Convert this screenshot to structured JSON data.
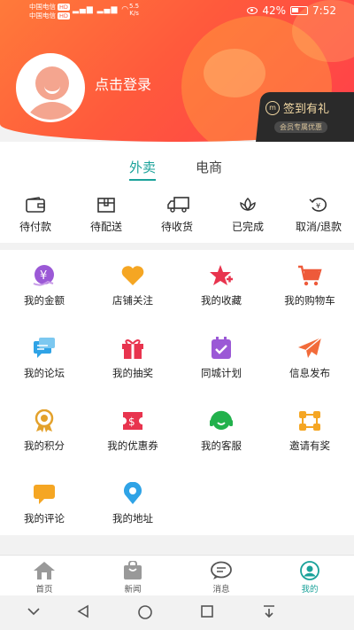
{
  "status_bar": {
    "carrier1": "中国电信",
    "carrier2": "中国电信",
    "hd": "HD",
    "speed_value": "5.5",
    "speed_unit": "K/s",
    "battery": "42%",
    "time": "7:52"
  },
  "profile": {
    "login_label": "点击登录"
  },
  "checkin": {
    "title": "签到有礼",
    "subtitle": "会员专属优惠"
  },
  "tabs": [
    {
      "label": "外卖"
    },
    {
      "label": "电商"
    }
  ],
  "orders": [
    {
      "label": "待付款",
      "icon": "wallet-icon"
    },
    {
      "label": "待配送",
      "icon": "box-icon"
    },
    {
      "label": "待收货",
      "icon": "truck-icon"
    },
    {
      "label": "已完成",
      "icon": "lotus-icon"
    },
    {
      "label": "取消/退款",
      "icon": "refund-icon"
    }
  ],
  "features": [
    {
      "label": "我的金额",
      "icon": "money-icon",
      "color": "#9b59d6"
    },
    {
      "label": "店铺关注",
      "icon": "heart-icon",
      "color": "#f5a623"
    },
    {
      "label": "我的收藏",
      "icon": "star-icon",
      "color": "#e8344e"
    },
    {
      "label": "我的购物车",
      "icon": "cart-icon",
      "color": "#ee5a3a"
    },
    {
      "label": "我的论坛",
      "icon": "chat-icon",
      "color": "#2fa3e6"
    },
    {
      "label": "我的抽奖",
      "icon": "gift-icon",
      "color": "#e8344e"
    },
    {
      "label": "同城计划",
      "icon": "calendar-check-icon",
      "color": "#9b59d6"
    },
    {
      "label": "信息发布",
      "icon": "paper-plane-icon",
      "color": "#f26b3a"
    },
    {
      "label": "我的积分",
      "icon": "medal-icon",
      "color": "#e3a12b"
    },
    {
      "label": "我的优惠券",
      "icon": "coupon-icon",
      "color": "#e8344e"
    },
    {
      "label": "我的客服",
      "icon": "headset-icon",
      "color": "#22b14c"
    },
    {
      "label": "邀请有奖",
      "icon": "share-nodes-icon",
      "color": "#f5a623"
    },
    {
      "label": "我的评论",
      "icon": "comment-icon",
      "color": "#f5a623"
    },
    {
      "label": "我的地址",
      "icon": "location-icon",
      "color": "#2fa3e6"
    }
  ],
  "nav": [
    {
      "label": "首页",
      "icon": "home-icon"
    },
    {
      "label": "新闻",
      "icon": "bag-icon"
    },
    {
      "label": "消息",
      "icon": "message-icon"
    },
    {
      "label": "我的",
      "icon": "user-icon"
    }
  ],
  "accent": "#1aa29a"
}
